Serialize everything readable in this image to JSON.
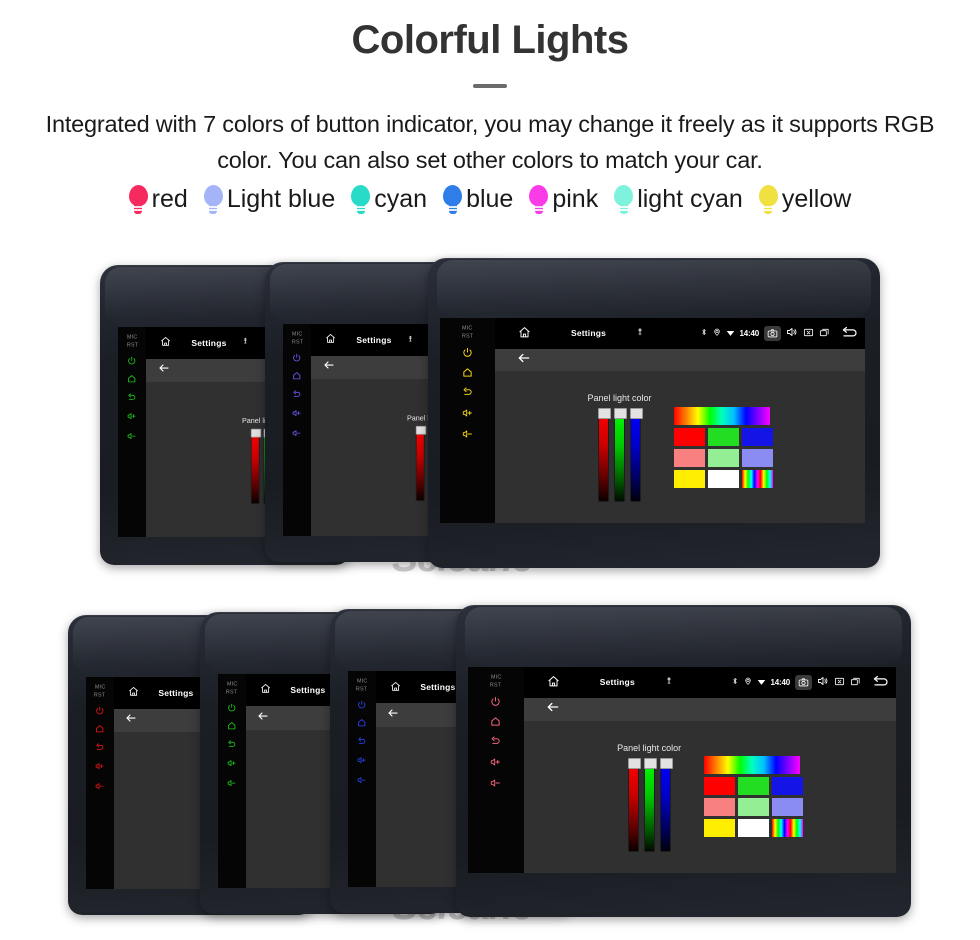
{
  "header": {
    "title": "Colorful Lights",
    "subtitle": "Integrated with 7 colors of button indicator, you may change it freely as it supports RGB color. You can also set other colors to match your car."
  },
  "legend": {
    "items": [
      {
        "label": "red",
        "color": "#f72a5f",
        "icon": "bulb-icon"
      },
      {
        "label": "Light blue",
        "color": "#a4b4f7",
        "icon": "bulb-icon"
      },
      {
        "label": "cyan",
        "color": "#27dbc8",
        "icon": "bulb-icon"
      },
      {
        "label": "blue",
        "color": "#2f7de8",
        "icon": "bulb-icon"
      },
      {
        "label": "pink",
        "color": "#f93ce8",
        "icon": "bulb-icon"
      },
      {
        "label": "light cyan",
        "color": "#7ff2de",
        "icon": "bulb-icon"
      },
      {
        "label": "yellow",
        "color": "#f0e040",
        "icon": "bulb-icon"
      }
    ]
  },
  "device": {
    "status_bar": {
      "home_icon": "home-icon",
      "title": "Settings",
      "mic_icon": "microphone-icon",
      "bluetooth_icon": "bluetooth-icon",
      "location_icon": "location-icon",
      "wifi_icon": "wifi-icon",
      "time": "14:40",
      "camera_icon": "camera-icon",
      "volume_icon": "volume-icon",
      "close_icon": "close-box-icon",
      "recents_icon": "recents-icon",
      "back_icon": "back-arrow-icon"
    },
    "action_bar": {
      "back_icon": "back-arrow-icon"
    },
    "panel": {
      "label": "Panel light color",
      "sliders": [
        {
          "name": "red",
          "value": 100,
          "color": "#ff0000"
        },
        {
          "name": "green",
          "value": 100,
          "color": "#00ff00"
        },
        {
          "name": "blue",
          "value": 100,
          "color": "#0000ff"
        }
      ],
      "swatch_rows": [
        [
          {
            "name": "rainbow-gradient",
            "color": "rainbow-h",
            "wide": true
          }
        ],
        [
          {
            "name": "red",
            "color": "#ff0000"
          },
          {
            "name": "green",
            "color": "#22dd22"
          },
          {
            "name": "blue",
            "color": "#1414e6"
          }
        ],
        [
          {
            "name": "light-red",
            "color": "#f98080"
          },
          {
            "name": "light-green",
            "color": "#94ef94"
          },
          {
            "name": "light-blue",
            "color": "#8a8cf4"
          }
        ],
        [
          {
            "name": "yellow",
            "color": "#ffee00"
          },
          {
            "name": "white",
            "color": "#ffffff"
          },
          {
            "name": "rainbow",
            "color": "rainbow-v"
          }
        ]
      ]
    },
    "key_strip": {
      "mic_label": "MIC",
      "rst_label": "RST",
      "keys": [
        "power-icon",
        "home-outline-icon",
        "back-icon",
        "volume-up-icon",
        "volume-down-icon"
      ]
    }
  },
  "rows": {
    "row1": [
      {
        "key_color": "#1ec61e",
        "name": "device-green",
        "full": false
      },
      {
        "key_color": "#6a5bf0",
        "name": "device-purple",
        "full": false
      },
      {
        "key_color": "#f2d417",
        "name": "device-yellow",
        "full": true
      }
    ],
    "row2": [
      {
        "key_color": "#e81414",
        "name": "device-red",
        "full": false
      },
      {
        "key_color": "#1ec61e",
        "name": "device-green-2",
        "full": false
      },
      {
        "key_color": "#2a46f0",
        "name": "device-blue",
        "full": false
      },
      {
        "key_color": "#f0647a",
        "name": "device-pink",
        "full": true
      }
    ]
  },
  "watermark": {
    "text": "Seicane"
  }
}
